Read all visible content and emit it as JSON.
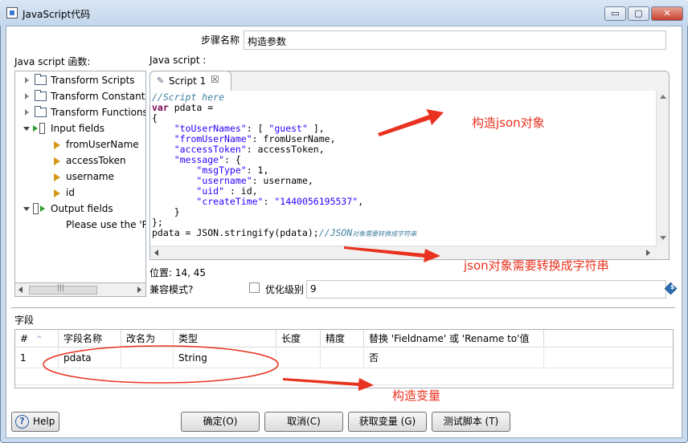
{
  "window": {
    "title": "JavaScript代码",
    "controls": {
      "minimize": "▭",
      "maximize": "▢",
      "close": "✕"
    }
  },
  "step": {
    "label": "步骤名称",
    "value": "构造参数"
  },
  "panels": {
    "functions_label": "Java script 函数:",
    "script_label": "Java script :"
  },
  "tree": {
    "items": [
      {
        "label": "Transform Scripts",
        "icon": "folder-icon",
        "expanded": false
      },
      {
        "label": "Transform Constants",
        "icon": "folder-icon",
        "expanded": false
      },
      {
        "label": "Transform Functions",
        "icon": "folder-icon",
        "expanded": false
      },
      {
        "label": "Input fields",
        "icon": "input-fields-icon",
        "expanded": true
      },
      {
        "label": "fromUserName",
        "icon": "field-icon"
      },
      {
        "label": "accessToken",
        "icon": "field-icon"
      },
      {
        "label": "username",
        "icon": "field-icon"
      },
      {
        "label": "id",
        "icon": "field-icon"
      },
      {
        "label": "Output fields",
        "icon": "output-fields-icon",
        "expanded": true
      },
      {
        "label": "Please use the 'R",
        "icon": ""
      }
    ],
    "hscroll_thumb_grip": "|||"
  },
  "editor": {
    "tab_label": "Script 1",
    "tab_close": "☒",
    "code_lines": [
      "//Script here",
      "var pdata =",
      "{",
      "    \"toUserNames\": [ \"guest\" ],",
      "    \"fromUserName\": fromUserName,",
      "    \"accessToken\": accessToken,",
      "    \"message\": {",
      "        \"msgType\": 1,",
      "        \"username\": username,",
      "        \"uid\" : id,",
      "        \"createTime\": \"1440056195537\",",
      "    }",
      "};",
      "pdata = JSON.stringify(pdata);//JSON对象需要转换成字符串"
    ]
  },
  "status": {
    "position": "位置: 14, 45",
    "compat_label": "兼容模式?",
    "optimize_label": "优化级别",
    "optimize_value": "9"
  },
  "fields": {
    "label": "字段",
    "columns": [
      "#",
      "字段名称",
      "改名为",
      "类型",
      "长度",
      "精度",
      "替换 'Fieldname' 或 'Rename to'值"
    ],
    "rows": [
      [
        "1",
        "pdata",
        "",
        "String",
        "",
        "",
        "否"
      ]
    ]
  },
  "buttons": {
    "help": "Help",
    "ok": "确定(O)",
    "cancel": "取消(C)",
    "get_vars": "获取变量 (G)",
    "test": "测试脚本 (T)"
  },
  "annotations": {
    "construct_json": "构造json对象",
    "json_to_string": "json对象需要转换成字符串",
    "construct_var": "构造变量",
    "color": "#e8321f"
  }
}
